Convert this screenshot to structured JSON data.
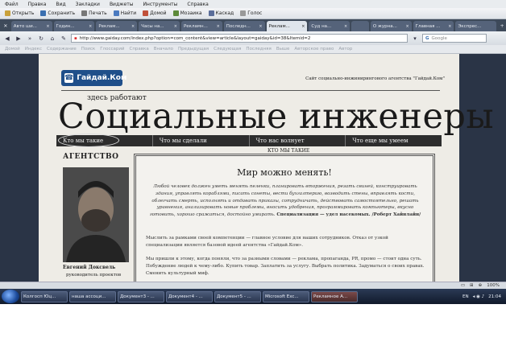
{
  "menubar": {
    "items": [
      "Файл",
      "Правка",
      "Вид",
      "Закладки",
      "Виджеты",
      "Инструменты",
      "Справка"
    ]
  },
  "bookmarks": {
    "items": [
      {
        "icon": "open-icon",
        "label": "Открыть"
      },
      {
        "icon": "save-icon",
        "label": "Сохранить"
      },
      {
        "icon": "print-icon",
        "label": "Печать"
      },
      {
        "icon": "find-icon",
        "label": "Найти"
      },
      {
        "icon": "home-icon",
        "label": "Домой"
      },
      {
        "icon": "mosaic-icon",
        "label": "Мозаика"
      },
      {
        "icon": "cascade-icon",
        "label": "Каскад"
      },
      {
        "icon": "voice-icon",
        "label": "Голос"
      }
    ]
  },
  "tabs": [
    {
      "label": "Авто ши...",
      "active": false
    },
    {
      "label": "Годин...",
      "active": false
    },
    {
      "label": "Реклам...",
      "active": false
    },
    {
      "label": "Часы на...",
      "active": false
    },
    {
      "label": "Рекламн...",
      "active": false
    },
    {
      "label": "Последн...",
      "active": false
    },
    {
      "label": "Реклам...",
      "active": true
    },
    {
      "label": "Суд на...",
      "active": false
    },
    {
      "label": "",
      "active": false
    },
    {
      "label": "О журна...",
      "active": false
    },
    {
      "label": "Главная ...",
      "active": false
    },
    {
      "label": "Экспрес...",
      "active": false
    }
  ],
  "nav": {
    "url": "http://www.gaiday.com/index.php?option=com_content&view=article&layout=gaiday&id=38&Itemid=2",
    "search_placeholder": "Google"
  },
  "gbar": {
    "items": [
      "Домой",
      "Индекс",
      "Содержание",
      "Поиск",
      "Глоссарий",
      "Справка",
      "Вначало",
      "Предыдущая",
      "Следующая",
      "Последняя",
      "Выше",
      "Авторское право",
      "Автор"
    ]
  },
  "page": {
    "logo_text": "Гайдай.Ком",
    "tagline": "Сайт социально-инжинирингового агентства \"Гайдай.Ком\"",
    "subtitle": "здесь работают",
    "title": "Социальные инженеры",
    "menu": [
      "Кто мы такие",
      "Что мы сделали",
      "Что нас волнует",
      "Что еще мы умеем"
    ],
    "sidebar_title": "АГЕНТСТВО",
    "person_name": "Евгений Доксвель",
    "person_role": "руководитель проектов",
    "section_label": "КТО МЫ ТАКИЕ",
    "article_title": "Мир можно менять!",
    "quote": "Любой человек должен уметь менять пеленки, планировать вторжения, резать свиней, конструировать здания, управлять кораблями, писать сонеты, вести бухгалтерию, возводить стены, вправлять кости, облегчать смерть, исполнять и отдавать приказы, сотрудничать, действовать самостоятельно, решать уравнения, анализировать новые проблемы, вносить удобрения, программировать компьютеры, вкусно готовить, хорошо сражаться, достойно умирать.",
    "quote_bold": "Специализация — удел насекомых. /Роберт Хайнлайн/",
    "p2": "Мыслить за рамками своей компетенции — главное условие для наших сотрудников. Отказ от узкой специализации является базовой идеей агентства «Гайдай.Ком».",
    "p3": "Мы пришли к этому, когда поняли, что за разными словами — реклама, пропаганда, PR, промо — стоит одна суть. Побуждение людей к чему-либо. Купить товар. Заплатить за услугу. Выбрать политика. Задуматься о своих правах. Сменить культурный миф."
  },
  "statusbar": {
    "zoom": "100%"
  },
  "taskbar": {
    "buttons": [
      "Колгосп Юц...",
      "наша ассоци...",
      "Документ3 - ...",
      "Документ4 - ...",
      "Документ5 - ...",
      "Microsoft Exc...",
      "Рекламное А..."
    ],
    "lang": "EN",
    "time": "21:04"
  }
}
